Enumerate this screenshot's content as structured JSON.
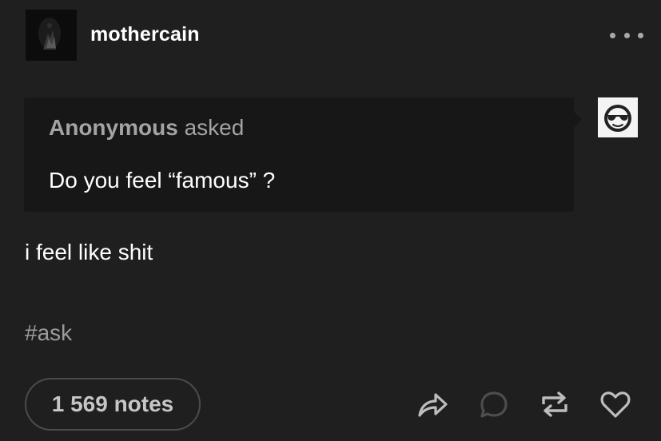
{
  "post": {
    "blog_name": "mothercain",
    "asker_name": "Anonymous",
    "asked_label": "asked",
    "question": "Do you feel “famous” ?",
    "answer": "i feel like shit",
    "tag": "#ask",
    "notes_count": "1 569 notes"
  },
  "icons": {
    "menu": "more-dots-icon",
    "anon_avatar": "sunglasses-face-icon",
    "actions": [
      "share-icon",
      "reply-icon",
      "reblog-icon",
      "like-icon"
    ]
  },
  "colors": {
    "background": "#1f1f1f",
    "ask_box": "#171717",
    "muted_text": "#a4a4a4",
    "icon": "#bdbdbd"
  }
}
